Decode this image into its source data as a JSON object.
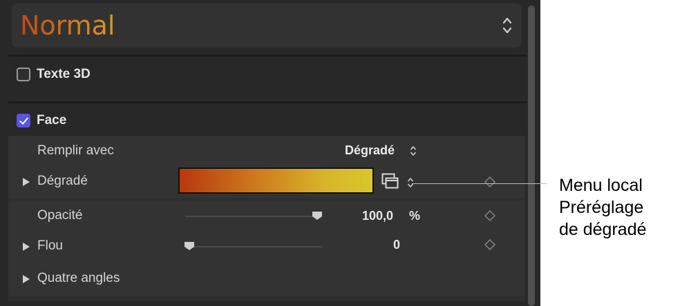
{
  "preset": {
    "title": "Normal"
  },
  "options": {
    "text_3d": {
      "label": "Texte 3D",
      "checked": false
    },
    "face": {
      "label": "Face",
      "checked": true
    }
  },
  "rows": {
    "fill_with": {
      "label": "Remplir avec",
      "value": "Dégradé"
    },
    "gradient": {
      "label": "Dégradé",
      "colors": [
        "#b8380e",
        "#cf7a1e",
        "#d8b42a",
        "#d8c72c"
      ]
    },
    "opacity": {
      "label": "Opacité",
      "value": "100,0",
      "unit": "%",
      "level": 1.0
    },
    "blur": {
      "label": "Flou",
      "value": "0",
      "level": 0.0
    },
    "four_corners": {
      "label": "Quatre angles"
    }
  },
  "callout": {
    "lines": [
      "Menu local",
      "Préréglage",
      "de dégradé"
    ]
  },
  "colors": {
    "accent": "#5a55de",
    "panel": "#282828"
  }
}
